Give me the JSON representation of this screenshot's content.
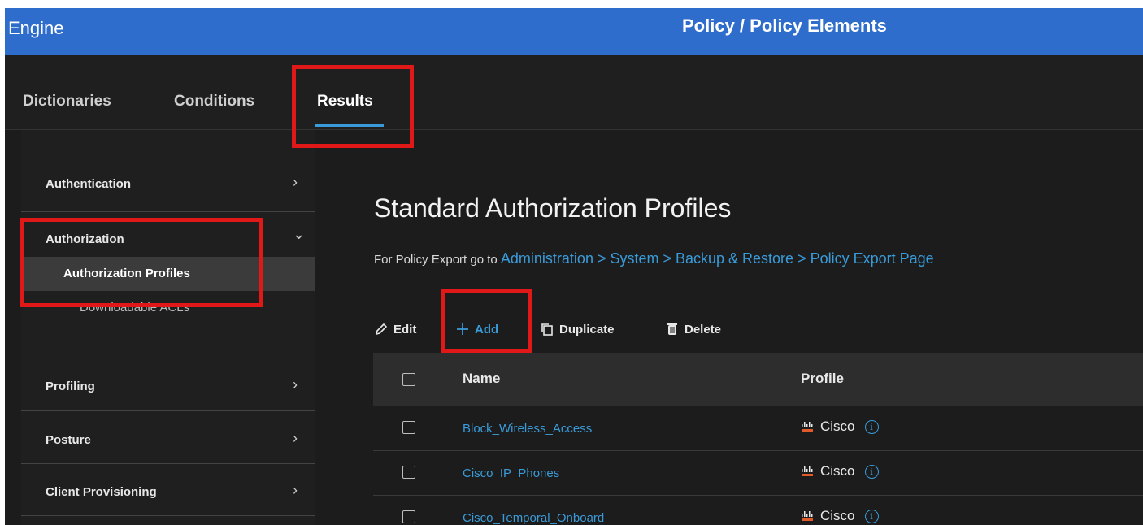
{
  "header": {
    "app_title": "Engine",
    "page_title": "Policy / Policy Elements"
  },
  "tabs": [
    {
      "label": "Dictionaries",
      "active": false
    },
    {
      "label": "Conditions",
      "active": false
    },
    {
      "label": "Results",
      "active": true
    }
  ],
  "sidebar": {
    "items": [
      {
        "label": "Authentication",
        "chevron": "chevron-right-icon"
      },
      {
        "label": "Authorization",
        "chevron": "chevron-down-icon",
        "expanded": true,
        "children": [
          {
            "label": "Authorization Profiles",
            "selected": true
          },
          {
            "label": "Downloadable ACLs",
            "selected": false
          }
        ]
      },
      {
        "label": "Profiling",
        "chevron": "chevron-right-icon"
      },
      {
        "label": "Posture",
        "chevron": "chevron-right-icon"
      },
      {
        "label": "Client Provisioning",
        "chevron": "chevron-right-icon"
      }
    ]
  },
  "main": {
    "title": "Standard Authorization Profiles",
    "export_prefix": "For Policy Export go to",
    "export_link": "Administration > System > Backup & Restore > Policy Export Page",
    "toolbar": {
      "edit_label": "Edit",
      "add_label": "Add",
      "duplicate_label": "Duplicate",
      "delete_label": "Delete"
    },
    "table": {
      "columns": [
        "Name",
        "Profile"
      ],
      "rows": [
        {
          "name": "Block_Wireless_Access",
          "profile": "Cisco"
        },
        {
          "name": "Cisco_IP_Phones",
          "profile": "Cisco"
        },
        {
          "name": "Cisco_Temporal_Onboard",
          "profile": "Cisco"
        }
      ]
    }
  },
  "colors": {
    "header_blue": "#2f6dcc",
    "link_blue": "#3a9bd9",
    "highlight_red": "#e01818",
    "background_dark": "#1c1c1c"
  }
}
